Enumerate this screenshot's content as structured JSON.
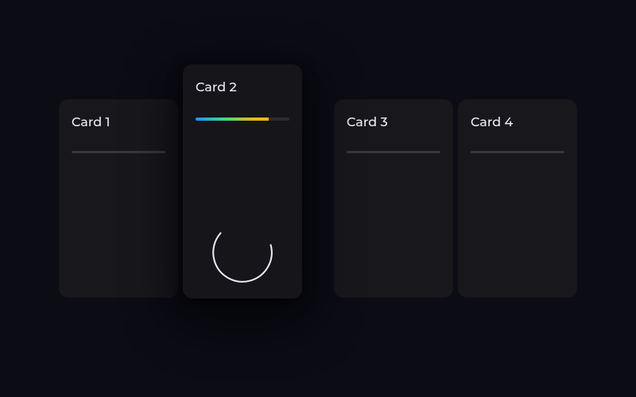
{
  "cards": [
    {
      "title": "Card 1",
      "active": false
    },
    {
      "title": "Card 2",
      "active": true
    },
    {
      "title": "Card 3",
      "active": false
    },
    {
      "title": "Card 4",
      "active": false
    }
  ]
}
